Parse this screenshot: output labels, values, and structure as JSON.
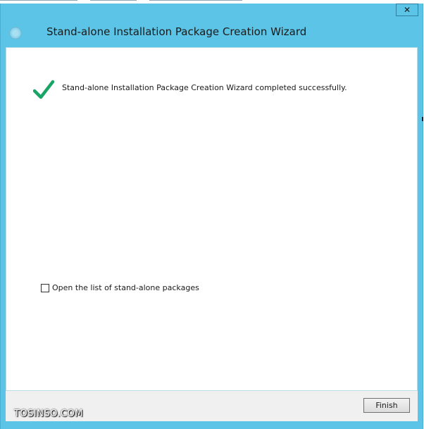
{
  "window": {
    "title": "Stand-alone Installation Package Creation Wizard",
    "close_symbol": "✕"
  },
  "content": {
    "success_message": "Stand-alone Installation Package Creation Wizard completed successfully.",
    "open_list_checkbox": {
      "label": "Open the list of stand-alone packages",
      "checked": false
    }
  },
  "footer": {
    "finish_label": "Finish"
  },
  "watermark": "TOSINSO.COM",
  "colors": {
    "frame": "#5cc4e6",
    "success_check": "#1aa566",
    "content_bg": "#ffffff",
    "footer_bg": "#f0f0f0"
  },
  "icons": {
    "title": "circle-icon",
    "success": "checkmark-icon",
    "close": "close-icon"
  }
}
